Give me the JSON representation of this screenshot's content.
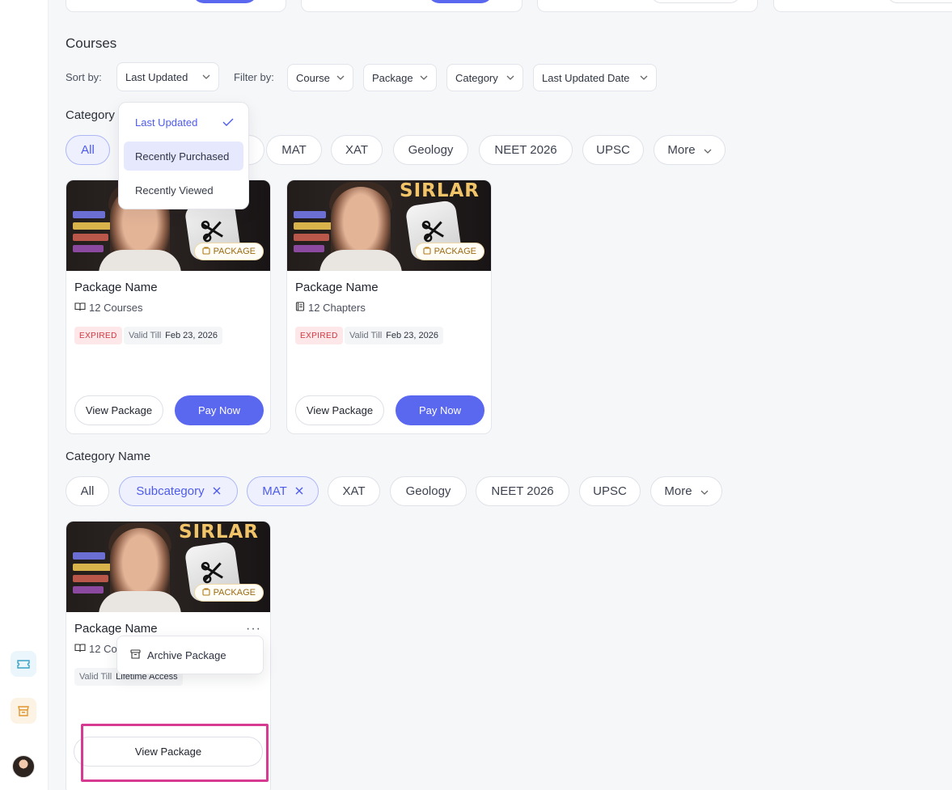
{
  "section": {
    "title": "Courses"
  },
  "sort": {
    "label": "Sort by:",
    "value": "Last Updated"
  },
  "filter": {
    "label": "Filter by:",
    "dropdowns": [
      "Course",
      "Package",
      "Category",
      "Last Updated Date"
    ]
  },
  "sort_menu": {
    "items": [
      {
        "label": "Last Updated",
        "checked": true
      },
      {
        "label": "Recently Purchased",
        "hover": true
      },
      {
        "label": "Recently Viewed"
      }
    ]
  },
  "group1": {
    "title": "Category",
    "chips": [
      "All",
      "MAT",
      "XAT",
      "Geology",
      "NEET 2026",
      "UPSC",
      "More"
    ],
    "cards": [
      {
        "title": "Package Name",
        "meta": "12 Courses",
        "status": "EXPIRED",
        "valid_label": "Valid Till",
        "valid_value": "Feb 23, 2026",
        "badge": "PACKAGE",
        "brand": "",
        "view_label": "View Package",
        "pay_label": "Pay Now"
      },
      {
        "title": "Package Name",
        "meta": "12 Chapters",
        "status": "EXPIRED",
        "valid_label": "Valid Till",
        "valid_value": "Feb 23, 2026",
        "badge": "PACKAGE",
        "brand": "SIRLAR",
        "view_label": "View Package",
        "pay_label": "Pay Now"
      }
    ]
  },
  "group2": {
    "title": "Category Name",
    "chips": [
      "All",
      "Subcategory",
      "MAT",
      "XAT",
      "Geology",
      "NEET 2026",
      "UPSC",
      "More"
    ],
    "card": {
      "title": "Package Name",
      "meta": "12 Co",
      "valid_label": "Valid Till",
      "valid_value": "Lifetime Access",
      "badge": "PACKAGE",
      "brand": "SIRLAR",
      "view_label": "View Package"
    },
    "context_menu": {
      "archive_label": "Archive Package"
    }
  },
  "colors": {
    "accent": "#5a67ef",
    "expired": "#d2363f",
    "highlight": "#d63a91"
  }
}
